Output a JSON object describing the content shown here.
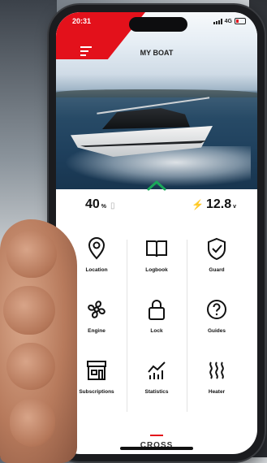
{
  "status": {
    "time": "20:31",
    "network": "4G"
  },
  "header": {
    "title": "MY BOAT"
  },
  "stats": {
    "battery_level": "40",
    "battery_unit": "%",
    "voltage": "12.8",
    "voltage_unit": "v"
  },
  "grid": [
    {
      "label": "Location",
      "icon": "location-pin-icon"
    },
    {
      "label": "Logbook",
      "icon": "book-icon"
    },
    {
      "label": "Guard",
      "icon": "shield-check-icon"
    },
    {
      "label": "Engine",
      "icon": "propeller-icon"
    },
    {
      "label": "Lock",
      "icon": "padlock-icon"
    },
    {
      "label": "Guides",
      "icon": "question-icon"
    },
    {
      "label": "Subscriptions",
      "icon": "store-icon"
    },
    {
      "label": "Statistics",
      "icon": "chart-icon"
    },
    {
      "label": "Heater",
      "icon": "heat-waves-icon"
    }
  ],
  "brand": {
    "name": "CROSS"
  },
  "colors": {
    "accent": "#e3111b",
    "chevron": "#1aa85a"
  }
}
